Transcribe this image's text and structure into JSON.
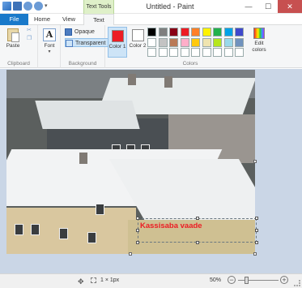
{
  "window": {
    "title": "Untitled - Paint",
    "context_tab": "Text Tools",
    "minimize": "—",
    "maximize": "☐",
    "close": "✕"
  },
  "tabs": {
    "file": "File",
    "home": "Home",
    "view": "View",
    "text": "Text"
  },
  "ribbon": {
    "clipboard": {
      "label": "Clipboard",
      "paste": "Paste"
    },
    "font": {
      "label": "Font",
      "glyph": "A"
    },
    "background": {
      "label": "Background",
      "opaque": "Opaque",
      "transparent": "Transparent"
    },
    "colors": {
      "label": "Colors",
      "color1": "Color 1",
      "color2": "Color 2",
      "color1_value": "#ec1c24",
      "color2_value": "#ffffff",
      "edit": "Edit colors",
      "palette": [
        "#000000",
        "#7f7f7f",
        "#880015",
        "#ed1c24",
        "#ff7f27",
        "#fff200",
        "#22b14c",
        "#00a2e8",
        "#3f48cc",
        "#ffffff",
        "#c3c3c3",
        "#b97a57",
        "#ffaec9",
        "#ffc90e",
        "#efe4b0",
        "#b5e61d",
        "#99d9ea",
        "#7092be",
        "#ffffff",
        "#ffffff",
        "#ffffff",
        "#ffffff",
        "#ffffff",
        "#ffffff",
        "#ffffff",
        "#ffffff",
        "#ffffff"
      ]
    }
  },
  "canvas": {
    "text_content": "Kassisaba vaade"
  },
  "status": {
    "size": "1 × 1px",
    "zoom": "50%",
    "zoom_minus": "−",
    "zoom_plus": "+"
  }
}
